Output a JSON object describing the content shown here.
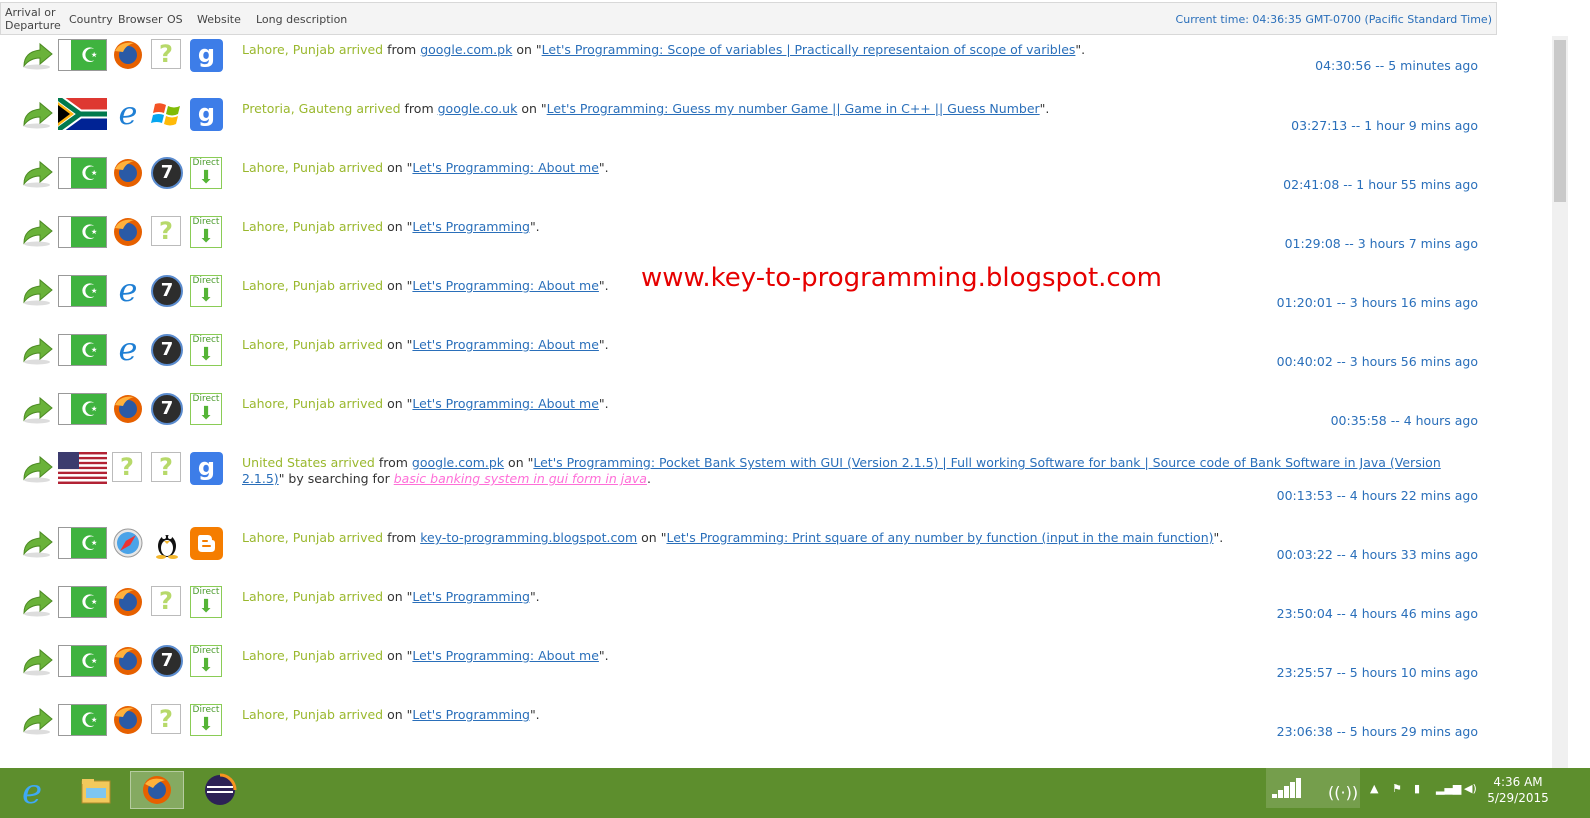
{
  "header": {
    "col_arrival_line1": "Arrival or",
    "col_arrival_line2": "Departure",
    "col_country": "Country",
    "col_browser": "Browser",
    "col_os": "OS",
    "col_website": "Website",
    "col_desc": "Long description",
    "current_time": "Current time: 04:36:35 GMT-0700 (Pacific Standard Time)"
  },
  "watermark": "www.key-to-programming.blogspot.com",
  "rows": [
    {
      "flag": "pk",
      "browser": "firefox",
      "os": "unknown",
      "site": "google",
      "location": "Lahore, Punjab arrived",
      "from_text": "from",
      "referrer": "google.com.pk",
      "on_text": "on",
      "open_quote": "\"",
      "page_title": "Let's Programming: Scope of variables | Practically representaion of scope of varibles",
      "close_quote": "\".",
      "time": "04:30:56 -- 5 minutes ago"
    },
    {
      "flag": "za",
      "browser": "ie",
      "os": "winxp",
      "site": "google",
      "location": "Pretoria, Gauteng arrived",
      "from_text": "from",
      "referrer": "google.co.uk",
      "on_text": "on",
      "open_quote": "\"",
      "page_title": "Let's Programming: Guess my number Game || Game in C++ || Guess Number",
      "close_quote": "\".",
      "time": "03:27:13 -- 1 hour 9 mins ago"
    },
    {
      "flag": "pk",
      "browser": "firefox",
      "os": "win7",
      "site": "direct",
      "location": "Lahore, Punjab arrived",
      "on_text": "on",
      "open_quote": "\"",
      "page_title": "Let's Programming: About me",
      "close_quote": "\".",
      "time": "02:41:08 -- 1 hour 55 mins ago"
    },
    {
      "flag": "pk",
      "browser": "firefox",
      "os": "unknown",
      "site": "direct",
      "location": "Lahore, Punjab arrived",
      "on_text": "on",
      "open_quote": "\"",
      "page_title": "Let's Programming",
      "close_quote": "\".",
      "time": "01:29:08 -- 3 hours 7 mins ago"
    },
    {
      "flag": "pk",
      "browser": "ie",
      "os": "win7",
      "site": "direct",
      "location": "Lahore, Punjab arrived",
      "on_text": "on",
      "open_quote": "\"",
      "page_title": "Let's Programming: About me",
      "close_quote": "\".",
      "time": "01:20:01 -- 3 hours 16 mins ago"
    },
    {
      "flag": "pk",
      "browser": "ie",
      "os": "win7",
      "site": "direct",
      "location": "Lahore, Punjab arrived",
      "on_text": "on",
      "open_quote": "\"",
      "page_title": "Let's Programming: About me",
      "close_quote": "\".",
      "time": "00:40:02 -- 3 hours 56 mins ago"
    },
    {
      "flag": "pk",
      "browser": "firefox",
      "os": "win7",
      "site": "direct",
      "location": "Lahore, Punjab arrived",
      "on_text": "on",
      "open_quote": "\"",
      "page_title": "Let's Programming: About me",
      "close_quote": "\".",
      "time": "00:35:58 -- 4 hours ago"
    },
    {
      "flag": "us",
      "browser": "unknown",
      "os": "unknown",
      "site": "google",
      "location": "United States arrived",
      "from_text": "from",
      "referrer": "google.com.pk",
      "on_text": "on",
      "open_quote": "\"",
      "page_title": "Let's Programming: Pocket Bank System with GUI (Version 2.1.5) | Full working Software for bank | Source code of Bank Software in Java (Version 2.1.5)",
      "search_prefix": "\" by searching for",
      "search_term": "basic banking system in gui form in java",
      "close_quote": ".",
      "time": "00:13:53 -- 4 hours 22 mins ago"
    },
    {
      "flag": "pk",
      "browser": "safari",
      "os": "linux",
      "site": "blogger",
      "location": "Lahore, Punjab arrived",
      "from_text": "from",
      "referrer": "key-to-programming.blogspot.com",
      "on_text": "on",
      "open_quote": "\"",
      "page_title": "Let's Programming: Print square of any number by function (input in the main function)",
      "close_quote": "\".",
      "time": "00:03:22 -- 4 hours 33 mins ago"
    },
    {
      "flag": "pk",
      "browser": "firefox",
      "os": "unknown",
      "site": "direct",
      "location": "Lahore, Punjab arrived",
      "on_text": "on",
      "open_quote": "\"",
      "page_title": "Let's Programming",
      "close_quote": "\".",
      "time": "23:50:04 -- 4 hours 46 mins ago"
    },
    {
      "flag": "pk",
      "browser": "firefox",
      "os": "win7",
      "site": "direct",
      "location": "Lahore, Punjab arrived",
      "on_text": "on",
      "open_quote": "\"",
      "page_title": "Let's Programming: About me",
      "close_quote": "\".",
      "time": "23:25:57 -- 5 hours 10 mins ago"
    },
    {
      "flag": "pk",
      "browser": "firefox",
      "os": "unknown",
      "site": "direct",
      "location": "Lahore, Punjab arrived",
      "on_text": "on",
      "open_quote": "\"",
      "page_title": "Let's Programming",
      "close_quote": "\".",
      "time": "23:06:38 -- 5 hours 29 mins ago"
    }
  ],
  "icons": {
    "unknown_glyph": "?",
    "google_glyph": "g",
    "direct_label": "Direct",
    "direct_glyph": "⬇",
    "pk_glyph": "☪",
    "win7_glyph": "7",
    "ie_glyph": "e"
  },
  "taskbar": {
    "clock_time": "4:36 AM",
    "clock_date": "5/29/2015"
  }
}
